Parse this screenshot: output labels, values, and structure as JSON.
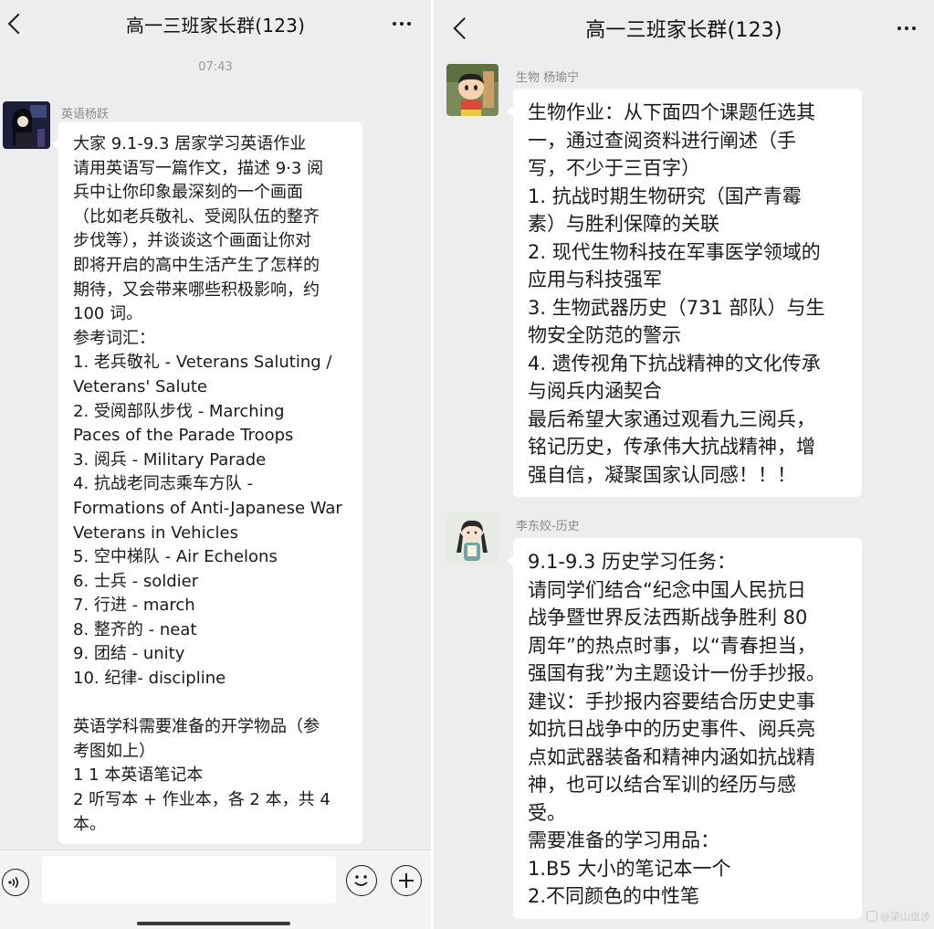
{
  "left": {
    "title": "高一三班家长群(123)",
    "timestamp": "07:43",
    "message": {
      "sender": "英语杨跃",
      "avatar": "dark-portrait-avatar",
      "text": "大家 9.1-9.3 居家学习英语作业\n请用英语写一篇作文，描述 9·3 阅\n兵中让你印象最深刻的一个画面\n（比如老兵敬礼、受阅队伍的整齐\n步伐等），并谈谈这个画面让你对\n即将开启的高中生活产生了怎样的\n期待，又会带来哪些积极影响，约\n100 词。\n参考词汇：\n1. 老兵敬礼 - Veterans Saluting /\nVeterans' Salute\n2. 受阅部队步伐 - Marching\nPaces of the Parade Troops\n3. 阅兵 - Military Parade\n4. 抗战老同志乘车方队 -\nFormations of Anti-Japanese War\nVeterans in Vehicles\n5. 空中梯队 - Air Echelons\n6. 士兵 - soldier\n7. 行进 - march\n8. 整齐的 - neat\n9. 团结 - unity\n10. 纪律- discipline\n\n英语学科需要准备的开学物品（参\n考图如上）\n1 1 本英语笔记本\n2 听写本 + 作业本，各 2 本，共 4\n本。"
    },
    "input": {
      "icons": [
        "voice-icon",
        "emoji-icon",
        "plus-icon"
      ]
    }
  },
  "right": {
    "title": "高一三班家长群(123)",
    "messages": [
      {
        "sender": "生物 杨瑜宁",
        "avatar": "cartoon-boy-avatar",
        "text": "生物作业：从下面四个课题任选其\n一，通过查阅资料进行阐述（手\n写，不少于三百字）\n1. 抗战时期生物研究（国产青霉\n素）与胜利保障的关联\n2. 现代生物科技在军事医学领域的\n应用与科技强军\n3. 生物武器历史（731 部队）与生\n物安全防范的警示\n4. 遗传视角下抗战精神的文化传承\n与阅兵内涵契合\n最后希望大家通过观看九三阅兵，\n铭记历史，传承伟大抗战精神，增\n强自信，凝聚国家认同感！！！"
      },
      {
        "sender": "李东姣-历史",
        "avatar": "cartoon-girl-avatar",
        "text": "9.1-9.3 历史学习任务：\n请同学们结合“纪念中国人民抗日\n战争暨世界反法西斯战争胜利 80\n周年”的热点时事，以“青春担当，\n强国有我”为主题设计一份手抄报。\n建议：手抄报内容要结合历史史事\n如抗日战争中的历史事件、阅兵亮\n点如武器装备和精神内涵如抗战精\n神，也可以结合军训的经历与感\n受。\n需要准备的学习用品：\n1.B5 大小的笔记本一个\n2.不同颜色的中性笔"
      }
    ],
    "watermark": "@梁山盘涉"
  },
  "colors": {
    "chat_background": "#ededed",
    "bubble": "#ffffff",
    "timestamp": "#9a9a9a",
    "sender_name": "#8a8a8a"
  }
}
